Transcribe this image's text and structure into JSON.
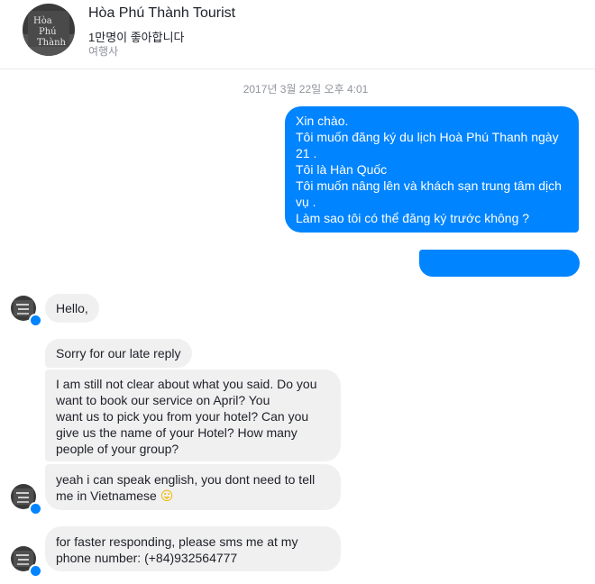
{
  "header": {
    "page_name": "Hòa Phú Thành Tourist",
    "likes": "1만명이 좋아합니다",
    "category": "여행사",
    "avatar_text": [
      "Hòa",
      "Phú",
      "Thành"
    ]
  },
  "conversation": {
    "timestamp": "2017년 3월 22일 오후 4:01",
    "outgoing_lines": [
      "Xin chào.",
      "Tôi muốn đăng ký du lịch Hoà Phú Thanh ngày",
      "21 .",
      "Tôi là Hàn Quốc",
      "Tôi muốn nâng lên và khách sạn trung tâm dịch",
      "vụ .",
      "Làm sao tôi có thể đăng ký trước không ?"
    ],
    "incoming": {
      "hello": "Hello,",
      "sorry": "Sorry for our late reply",
      "clarify_lines": [
        "I am still not clear about what you said. Do you",
        "want to book our service on          April? You",
        "want us to pick you from your hotel? Can you",
        "give us the name of your Hotel? How many",
        "people of your group?"
      ],
      "english_lines": [
        "yeah i can speak english, you dont need to tell",
        "me in Vietnamese"
      ],
      "english_emoji": "😛",
      "sms_lines": [
        "for faster responding, please sms me at my",
        "phone number: (+84)932564777"
      ]
    }
  },
  "colors": {
    "outgoing_bubble": "#0084ff",
    "incoming_bubble": "#f1f0f0",
    "timestamp": "#90949c"
  }
}
